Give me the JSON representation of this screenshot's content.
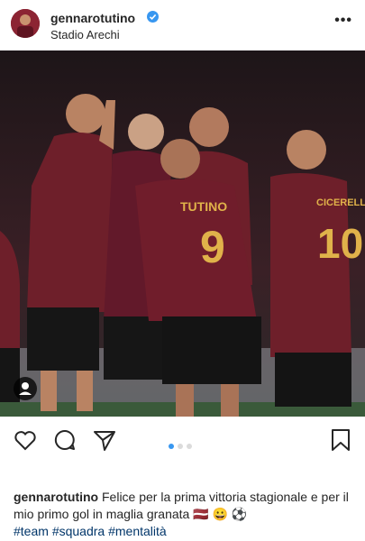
{
  "post": {
    "username": "gennarotutino",
    "location": "Stadio Arechi",
    "more_label": "•••"
  },
  "photo": {
    "players": [
      {
        "name": "TUTINO",
        "number": "9"
      },
      {
        "name": "CICERELLI",
        "number": "10"
      }
    ]
  },
  "carousel": {
    "count": 3,
    "active": 1
  },
  "caption": {
    "username": "gennarotutino",
    "text": "Felice per la prima vittoria stagionale e per il mio primo gol in maglia granata 🇱🇻 😀 ⚽",
    "hashtags": [
      "#team",
      "#squadra",
      "#mentalità"
    ]
  },
  "colors": {
    "accent": "#3897f0",
    "hashtag": "#003569",
    "jersey": "#6e1f2a",
    "jersey_text": "#e0b24a"
  },
  "icons": [
    "verified-badge-icon",
    "more-options-icon",
    "user-tag-icon",
    "heart-icon",
    "comment-icon",
    "share-icon",
    "bookmark-icon"
  ]
}
